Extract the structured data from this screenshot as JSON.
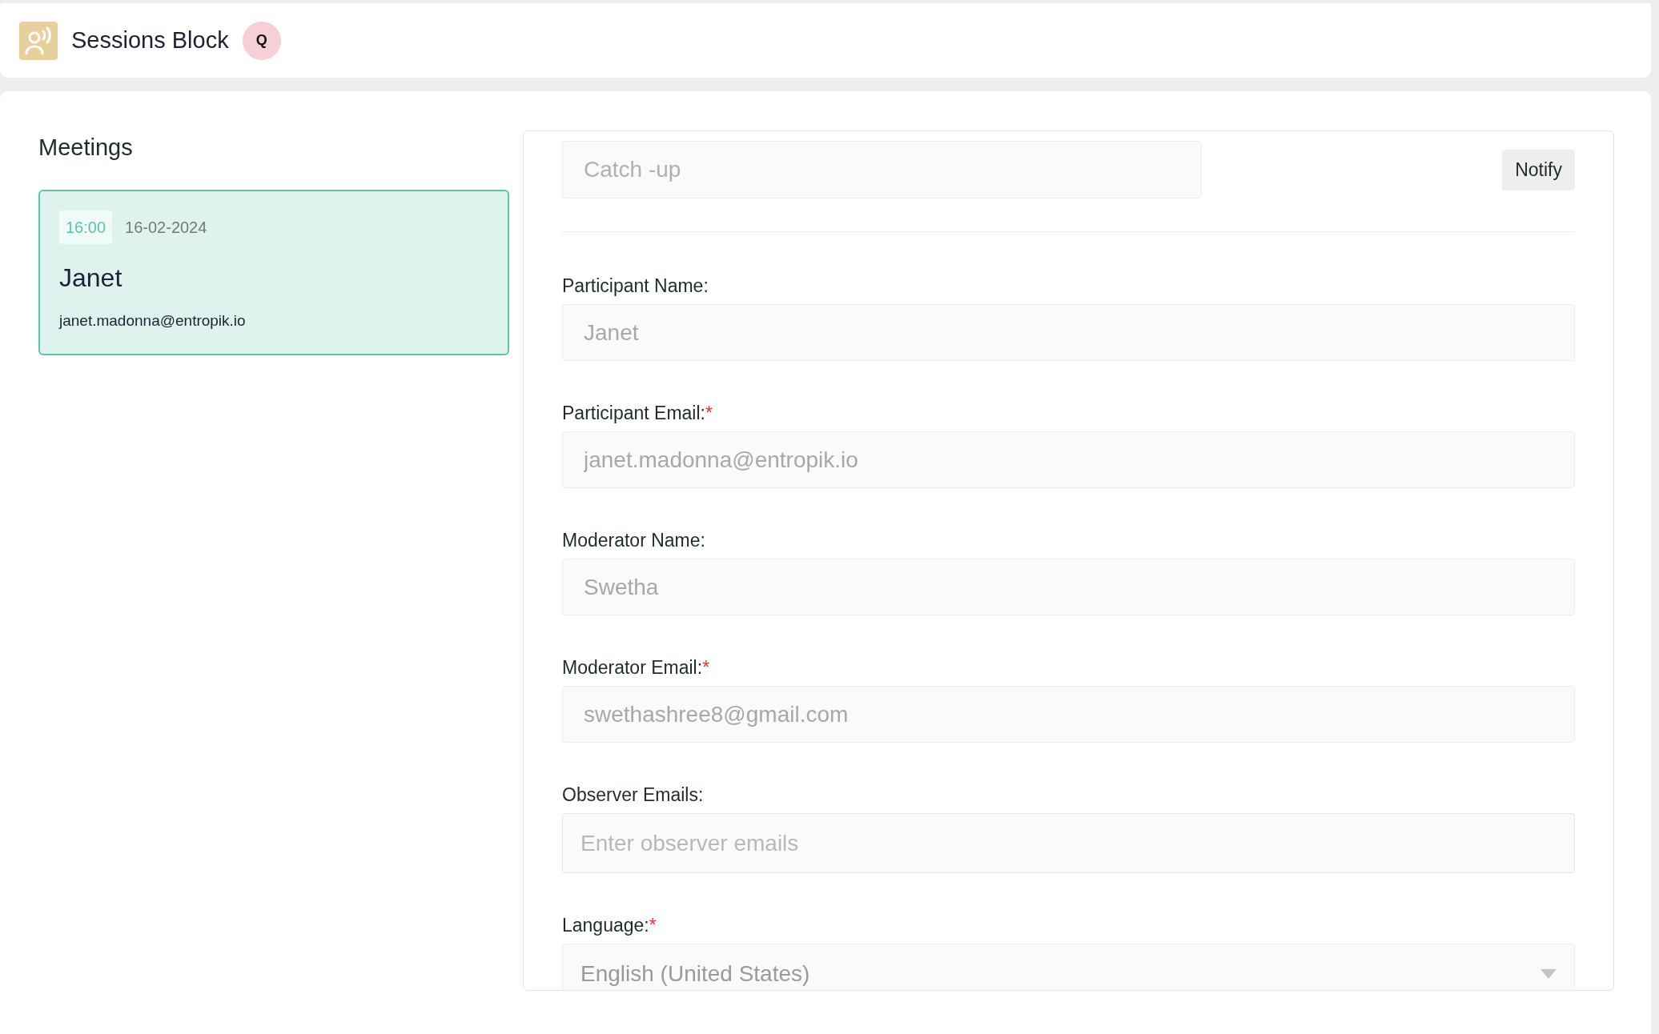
{
  "header": {
    "title": "Sessions Block",
    "avatar": "Q"
  },
  "meetings": {
    "title": "Meetings",
    "items": [
      {
        "time": "16:00",
        "date": "16-02-2024",
        "name": "Janet",
        "email": "janet.madonna@entropik.io",
        "selected": true
      }
    ]
  },
  "form": {
    "title_value": "Catch -up",
    "notify_button": "Notify",
    "fields": [
      {
        "kind": "text",
        "label": "Participant Name:",
        "value": "Janet"
      },
      {
        "kind": "text",
        "label": "Participant Email:",
        "required_mark": "*",
        "value": "janet.madonna@entropik.io"
      },
      {
        "kind": "text",
        "label": "Moderator Name:",
        "value": "Swetha"
      },
      {
        "kind": "text",
        "label": "Moderator Email:",
        "required_mark": "*",
        "value": "swethashree8@gmail.com"
      },
      {
        "kind": "input",
        "label": "Observer Emails:",
        "placeholder": "Enter observer emails"
      },
      {
        "kind": "select",
        "label": "Language:",
        "required_mark": "*",
        "value": "English (United States)"
      }
    ]
  }
}
